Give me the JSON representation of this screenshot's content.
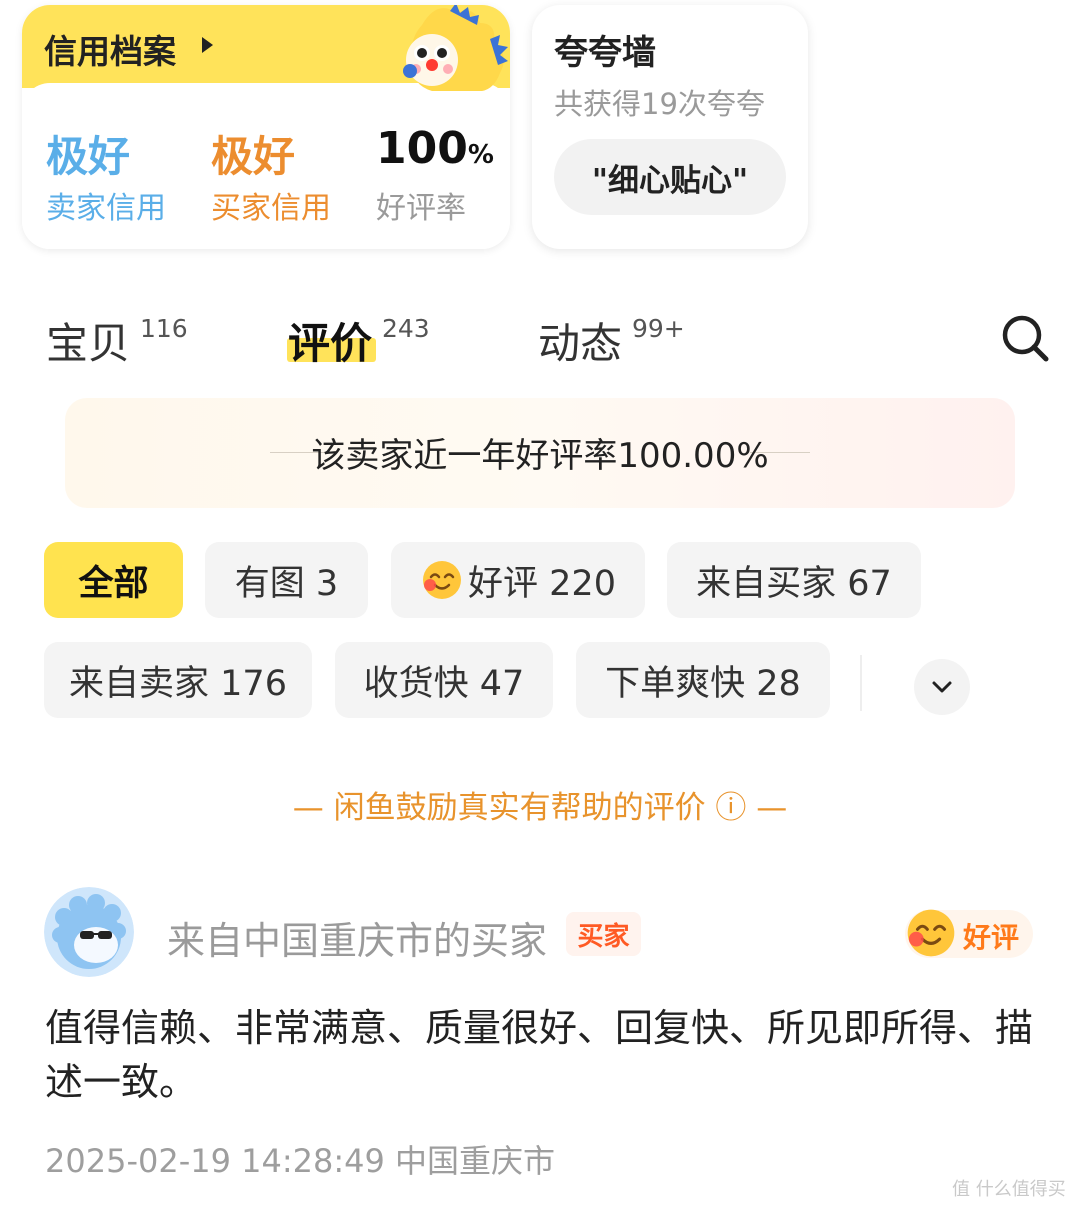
{
  "credit": {
    "title": "信用档案",
    "seller_value": "极好",
    "seller_label": "卖家信用",
    "buyer_value": "极好",
    "buyer_label": "买家信用",
    "rate_value": "100",
    "rate_unit": "%",
    "rate_label": "好评率",
    "colors": {
      "header_bg": "#ffe35a",
      "seller": "#5aaee8",
      "buyer": "#ec8d2f"
    }
  },
  "praise": {
    "title": "夸夸墙",
    "subtitle": "共获得19次夸夸",
    "tag": "\"细心贴心\""
  },
  "tabs": [
    {
      "label": "宝贝",
      "count": "116",
      "active": false
    },
    {
      "label": "评价",
      "count": "243",
      "active": true
    },
    {
      "label": "动态",
      "count": "99+",
      "active": false
    }
  ],
  "search": {
    "icon": "search-icon"
  },
  "rate_banner": {
    "text": "该卖家近一年好评率100.00%"
  },
  "filters": [
    {
      "label": "全部",
      "active": true
    },
    {
      "label": "有图 3",
      "active": false
    },
    {
      "label": "好评 220",
      "active": false,
      "icon": "smile-emoji-icon"
    },
    {
      "label": "来自买家 67",
      "active": false
    },
    {
      "label": "来自卖家 176",
      "active": false
    },
    {
      "label": "收货快 47",
      "active": false
    },
    {
      "label": "下单爽快 28",
      "active": false
    }
  ],
  "notice": {
    "text": "— 闲鱼鼓励真实有帮助的评价 ⓘ —",
    "color": "#e8932c"
  },
  "review": {
    "reviewer": "来自中国重庆市的买家",
    "role": "买家",
    "rating": "好评",
    "text": "值得信赖、非常满意、质量很好、回复快、所见即所得、描述一致。",
    "meta": "2025-02-19 14:28:49 中国重庆市"
  },
  "watermark": {
    "text": "值 什么值得买"
  }
}
